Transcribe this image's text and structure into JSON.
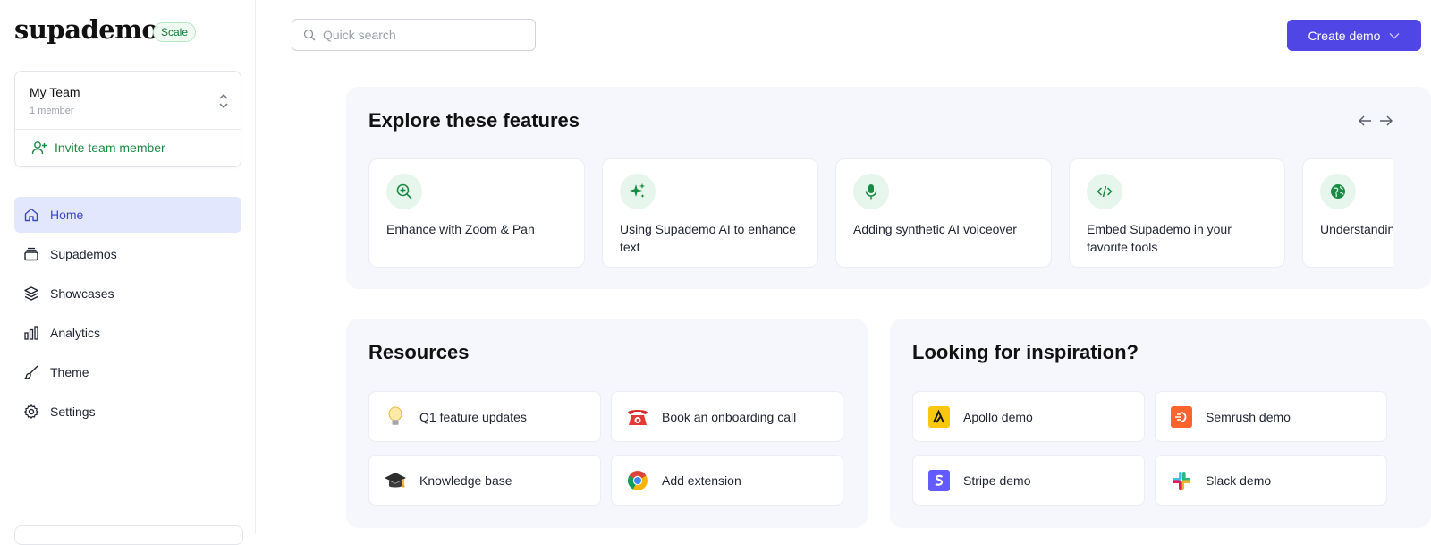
{
  "brand": {
    "name": "supademo",
    "plan": "Scale"
  },
  "team": {
    "name": "My Team",
    "members": "1 member",
    "invite_label": "Invite team member"
  },
  "nav": [
    {
      "label": "Home",
      "icon": "home-icon",
      "active": true
    },
    {
      "label": "Supademos",
      "icon": "stack-icon"
    },
    {
      "label": "Showcases",
      "icon": "layers-icon"
    },
    {
      "label": "Analytics",
      "icon": "bar-chart-icon"
    },
    {
      "label": "Theme",
      "icon": "brush-icon"
    },
    {
      "label": "Settings",
      "icon": "gear-icon"
    }
  ],
  "search": {
    "placeholder": "Quick search",
    "value": ""
  },
  "create_button": {
    "label": "Create demo"
  },
  "features": {
    "title": "Explore these features",
    "items": [
      {
        "label": "Enhance with Zoom & Pan",
        "icon": "zoom-in-icon"
      },
      {
        "label": "Using Supademo AI to enhance text",
        "icon": "sparkles-icon"
      },
      {
        "label": "Adding synthetic AI voiceover",
        "icon": "microphone-icon"
      },
      {
        "label": "Embed Supademo in your favorite tools",
        "icon": "code-icon"
      },
      {
        "label": "Understanding",
        "icon": "globe-icon"
      }
    ]
  },
  "resources": {
    "title": "Resources",
    "items": [
      {
        "label": "Q1 feature updates",
        "icon": "lightbulb-icon"
      },
      {
        "label": "Book an onboarding call",
        "icon": "telephone-icon"
      },
      {
        "label": "Knowledge base",
        "icon": "graduation-cap-icon"
      },
      {
        "label": "Add extension",
        "icon": "chrome-icon"
      }
    ]
  },
  "inspiration": {
    "title": "Looking for inspiration?",
    "items": [
      {
        "label": "Apollo demo",
        "icon": "apollo-logo-icon"
      },
      {
        "label": "Semrush demo",
        "icon": "semrush-logo-icon"
      },
      {
        "label": "Stripe demo",
        "icon": "stripe-logo-icon"
      },
      {
        "label": "Slack demo",
        "icon": "slack-logo-icon"
      }
    ]
  },
  "colors": {
    "accent": "#4f46e5",
    "green": "#1b8a43",
    "panel_bg": "#f6f6fd",
    "nav_active_bg": "#e3e7fd"
  }
}
